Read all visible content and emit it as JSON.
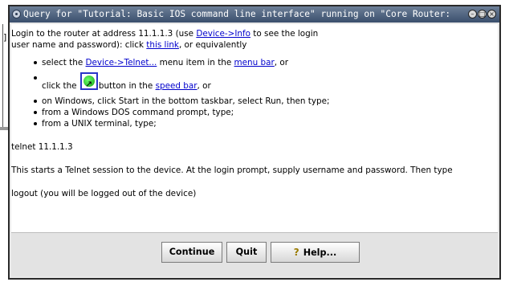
{
  "window": {
    "title": "Query for \"Tutorial: Basic IOS command line interface\" running on \"Core Router:"
  },
  "background": {
    "left_mark": "]"
  },
  "titlebar_buttons": {
    "minimize": "–",
    "maximize": "□",
    "close": "×"
  },
  "content": {
    "p1_a": "Login to the router at address 11.1.1.3 (use ",
    "p1_link_device_info": "Device->Info",
    "p1_b": " to see the login",
    "p1_c": "user name and password): click ",
    "p1_link_this": "this link",
    "p1_d": ", or equivalently",
    "steps": {
      "s1_a": "select the ",
      "s1_link_telnet": "Device->Telnet...",
      "s1_b": " menu item in the ",
      "s1_link_menubar": "menu bar",
      "s1_c": ", or",
      "s2_a": "click the ",
      "s2_b": "button in the ",
      "s2_link_speedbar": "speed bar",
      "s2_c": ", or",
      "s3": "on Windows, click Start in the bottom taskbar, select Run, then type;",
      "s4": "from a Windows DOS command prompt, type;",
      "s5": "from a UNIX terminal, type;"
    },
    "cmd_telnet": "telnet 11.1.1.3",
    "info": "This starts a Telnet session to the device. At the login prompt, supply username and password. Then type",
    "logout": "logout (you will be logged out of the device)"
  },
  "buttons": {
    "continue": "Continue",
    "quit": "Quit",
    "help": "Help..."
  },
  "icons": {
    "speed_icon": "telnet-speed-icon",
    "help_icon": "help-icon"
  }
}
